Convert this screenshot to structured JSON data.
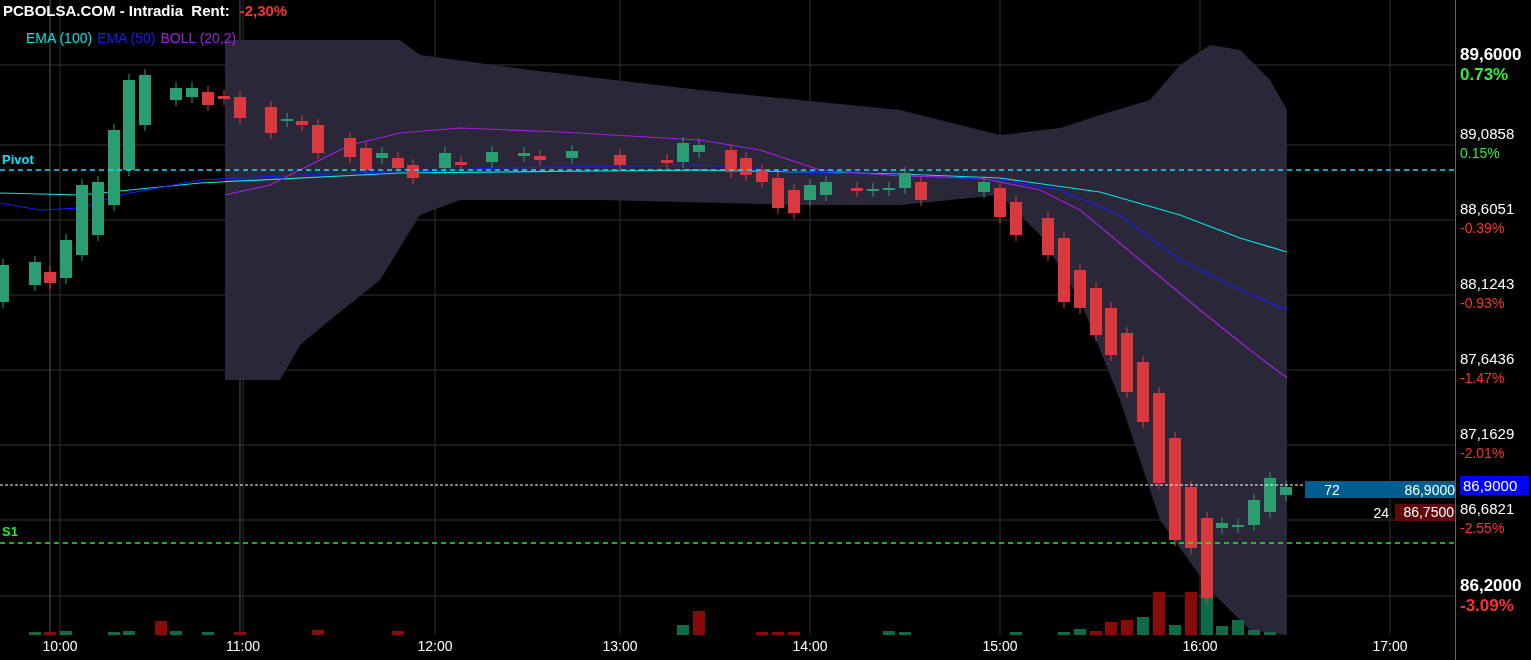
{
  "header": {
    "title": "PCBOLSA.COM - Intradia  Rent:",
    "change": "-2,30%"
  },
  "legend": [
    {
      "label": "EMA (100)",
      "color": "#00e5e5"
    },
    {
      "label": "EMA (50)",
      "color": "#1a1aff"
    },
    {
      "label": "BOLL (20,2)",
      "color": "#a020e0"
    }
  ],
  "levels": [
    {
      "label": "Pivot",
      "kind": "pivot",
      "color": "#00e5ff"
    },
    {
      "label": "S1",
      "kind": "support",
      "color": "#22ee22"
    }
  ],
  "order_book": [
    {
      "quantity": "72",
      "price": "86,9000",
      "kind": "bid"
    },
    {
      "quantity": "24",
      "price": "86,7500",
      "kind": "ask"
    }
  ],
  "price_axis": [
    {
      "price": "89,6000",
      "change": "0.73%",
      "positive": true,
      "emphasis": true
    },
    {
      "price": "89,0858",
      "change": "0.15%",
      "positive": true,
      "emphasis": false
    },
    {
      "price": "88,6051",
      "change": "-0.39%",
      "positive": false,
      "emphasis": false
    },
    {
      "price": "88,1243",
      "change": "-0.93%",
      "positive": false,
      "emphasis": false
    },
    {
      "price": "87,6436",
      "change": "-1.47%",
      "positive": false,
      "emphasis": false
    },
    {
      "price": "87,1629",
      "change": "-2.01%",
      "positive": false,
      "emphasis": false
    },
    {
      "price": "86,6821",
      "change": "-2.55%",
      "positive": false,
      "emphasis": false
    },
    {
      "price": "86,2000",
      "change": "-3.09%",
      "positive": false,
      "emphasis": true
    }
  ],
  "price_tag": "86,9000",
  "time_axis": [
    "10:00",
    "11:00",
    "12:00",
    "13:00",
    "14:00",
    "15:00",
    "16:00",
    "17:00"
  ]
}
